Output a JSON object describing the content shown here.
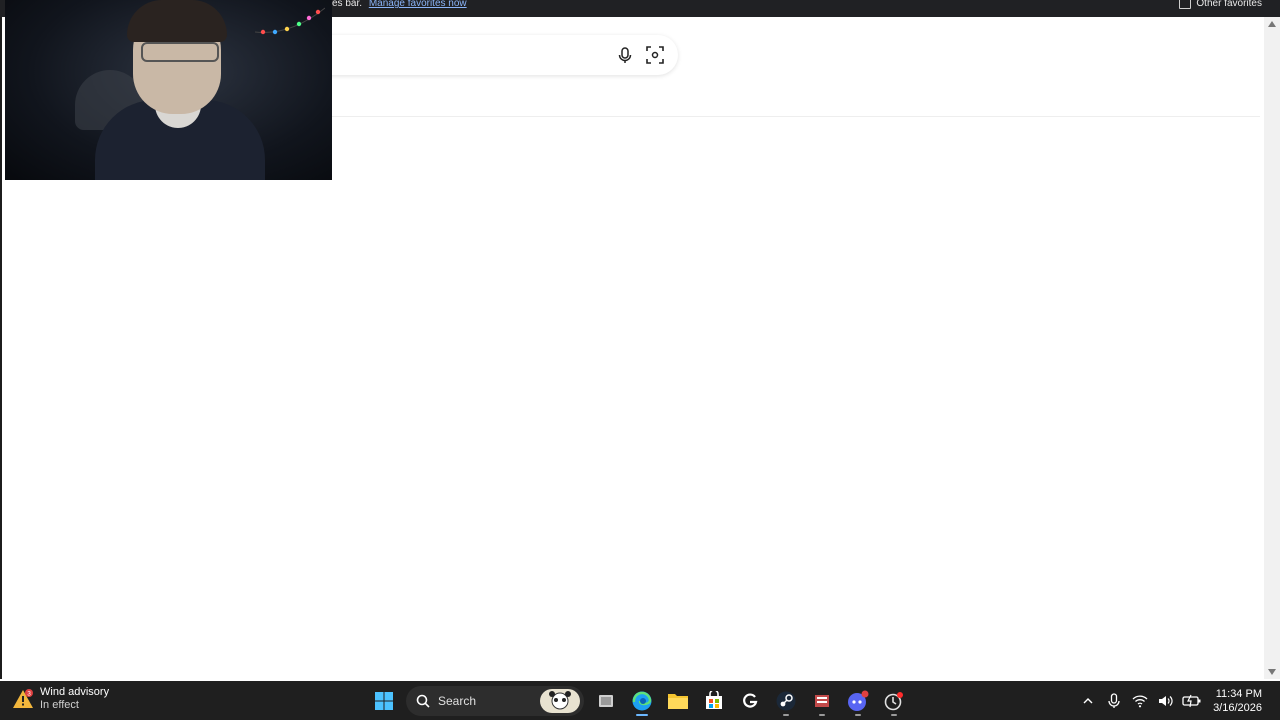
{
  "favorites_bar": {
    "message_fragment": "es bar.",
    "manage_link": "Manage favorites now",
    "other_favorites": "Other favorites"
  },
  "search": {
    "voice_icon": "microphone-icon",
    "visual_icon": "visual-search-icon"
  },
  "webcam": {
    "description_icon": "webcam-feed"
  },
  "taskbar": {
    "weather": {
      "badge": "3",
      "title": "Wind advisory",
      "subtitle": "In effect"
    },
    "search_label": "Search",
    "apps": [
      {
        "name": "start-icon"
      },
      {
        "name": "task-view-icon"
      },
      {
        "name": "edge-icon",
        "active": true
      },
      {
        "name": "file-explorer-icon"
      },
      {
        "name": "microsoft-store-icon"
      },
      {
        "name": "g-app-icon"
      },
      {
        "name": "steam-icon"
      },
      {
        "name": "app-icon"
      },
      {
        "name": "discord-icon"
      },
      {
        "name": "app-with-badge-icon"
      }
    ],
    "clock": {
      "time": "11:34 PM",
      "date": "3/16/2026"
    }
  },
  "colors": {
    "taskbar_bg": "#1f1f1f",
    "favbar_bg": "#202124",
    "link": "#8ab4f8",
    "accent": "#6cb8ff"
  }
}
